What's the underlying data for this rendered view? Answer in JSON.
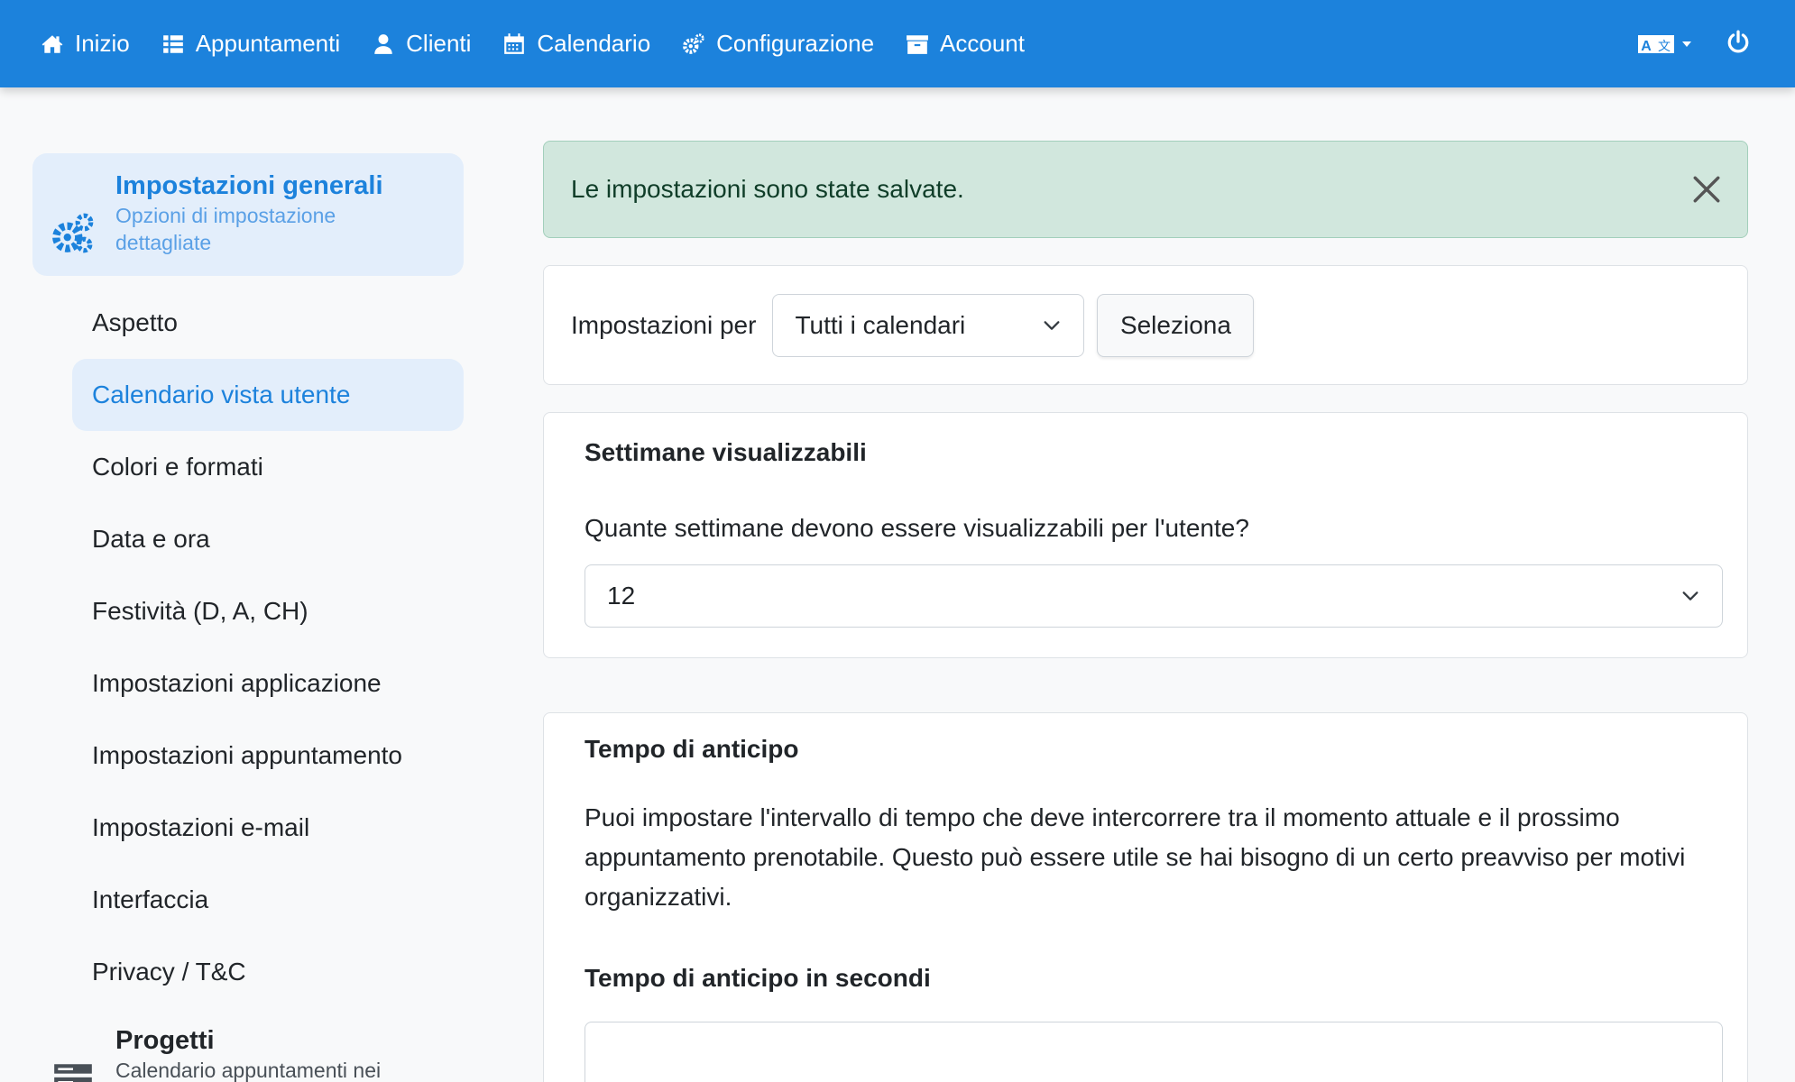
{
  "nav": {
    "items": [
      {
        "label": "Inizio",
        "icon": "home-icon"
      },
      {
        "label": "Appuntamenti",
        "icon": "list-icon"
      },
      {
        "label": "Clienti",
        "icon": "user-icon"
      },
      {
        "label": "Calendario",
        "icon": "calendar-icon"
      },
      {
        "label": "Configurazione",
        "icon": "gears-icon"
      },
      {
        "label": "Account",
        "icon": "archive-icon"
      }
    ],
    "language_icon": "language-icon",
    "power_icon": "power-icon"
  },
  "sidebar": {
    "group_general": {
      "title": "Impostazioni generali",
      "subtitle": "Opzioni di impostazione dettagliate",
      "icon": "gears-icon"
    },
    "items": [
      {
        "label": "Aspetto"
      },
      {
        "label": "Calendario vista utente",
        "active": true
      },
      {
        "label": "Colori e formati"
      },
      {
        "label": "Data e ora"
      },
      {
        "label": "Festività (D, A, CH)"
      },
      {
        "label": "Impostazioni applicazione"
      },
      {
        "label": "Impostazioni appuntamento"
      },
      {
        "label": "Impostazioni e-mail"
      },
      {
        "label": "Interfaccia"
      },
      {
        "label": "Privacy / T&C"
      }
    ],
    "group_projects": {
      "title": "Progetti",
      "subtitle": "Calendario appuntamenti nei",
      "icon": "server-icon"
    }
  },
  "alert": {
    "message": "Le impostazioni sono state salvate.",
    "close_icon": "close-icon"
  },
  "settings_for": {
    "label": "Impostazioni per",
    "selected": "Tutti i calendari",
    "button": "Seleziona"
  },
  "weeks": {
    "title": "Settimane visualizzabili",
    "question": "Quante settimane devono essere visualizzabili per l'utente?",
    "value": "12"
  },
  "advance": {
    "title": "Tempo di anticipo",
    "description": "Puoi impostare l'intervallo di tempo che deve intercorrere tra il momento attuale e il prossimo appuntamento prenotabile. Questo può essere utile se hai bisogno di un certo preavviso per motivi organizzativi.",
    "field_label": "Tempo di anticipo in secondi",
    "field_value": ""
  },
  "colors": {
    "primary": "#1c82dc",
    "alert_bg": "#d1e7dd",
    "active_bg": "#e3eefb"
  }
}
